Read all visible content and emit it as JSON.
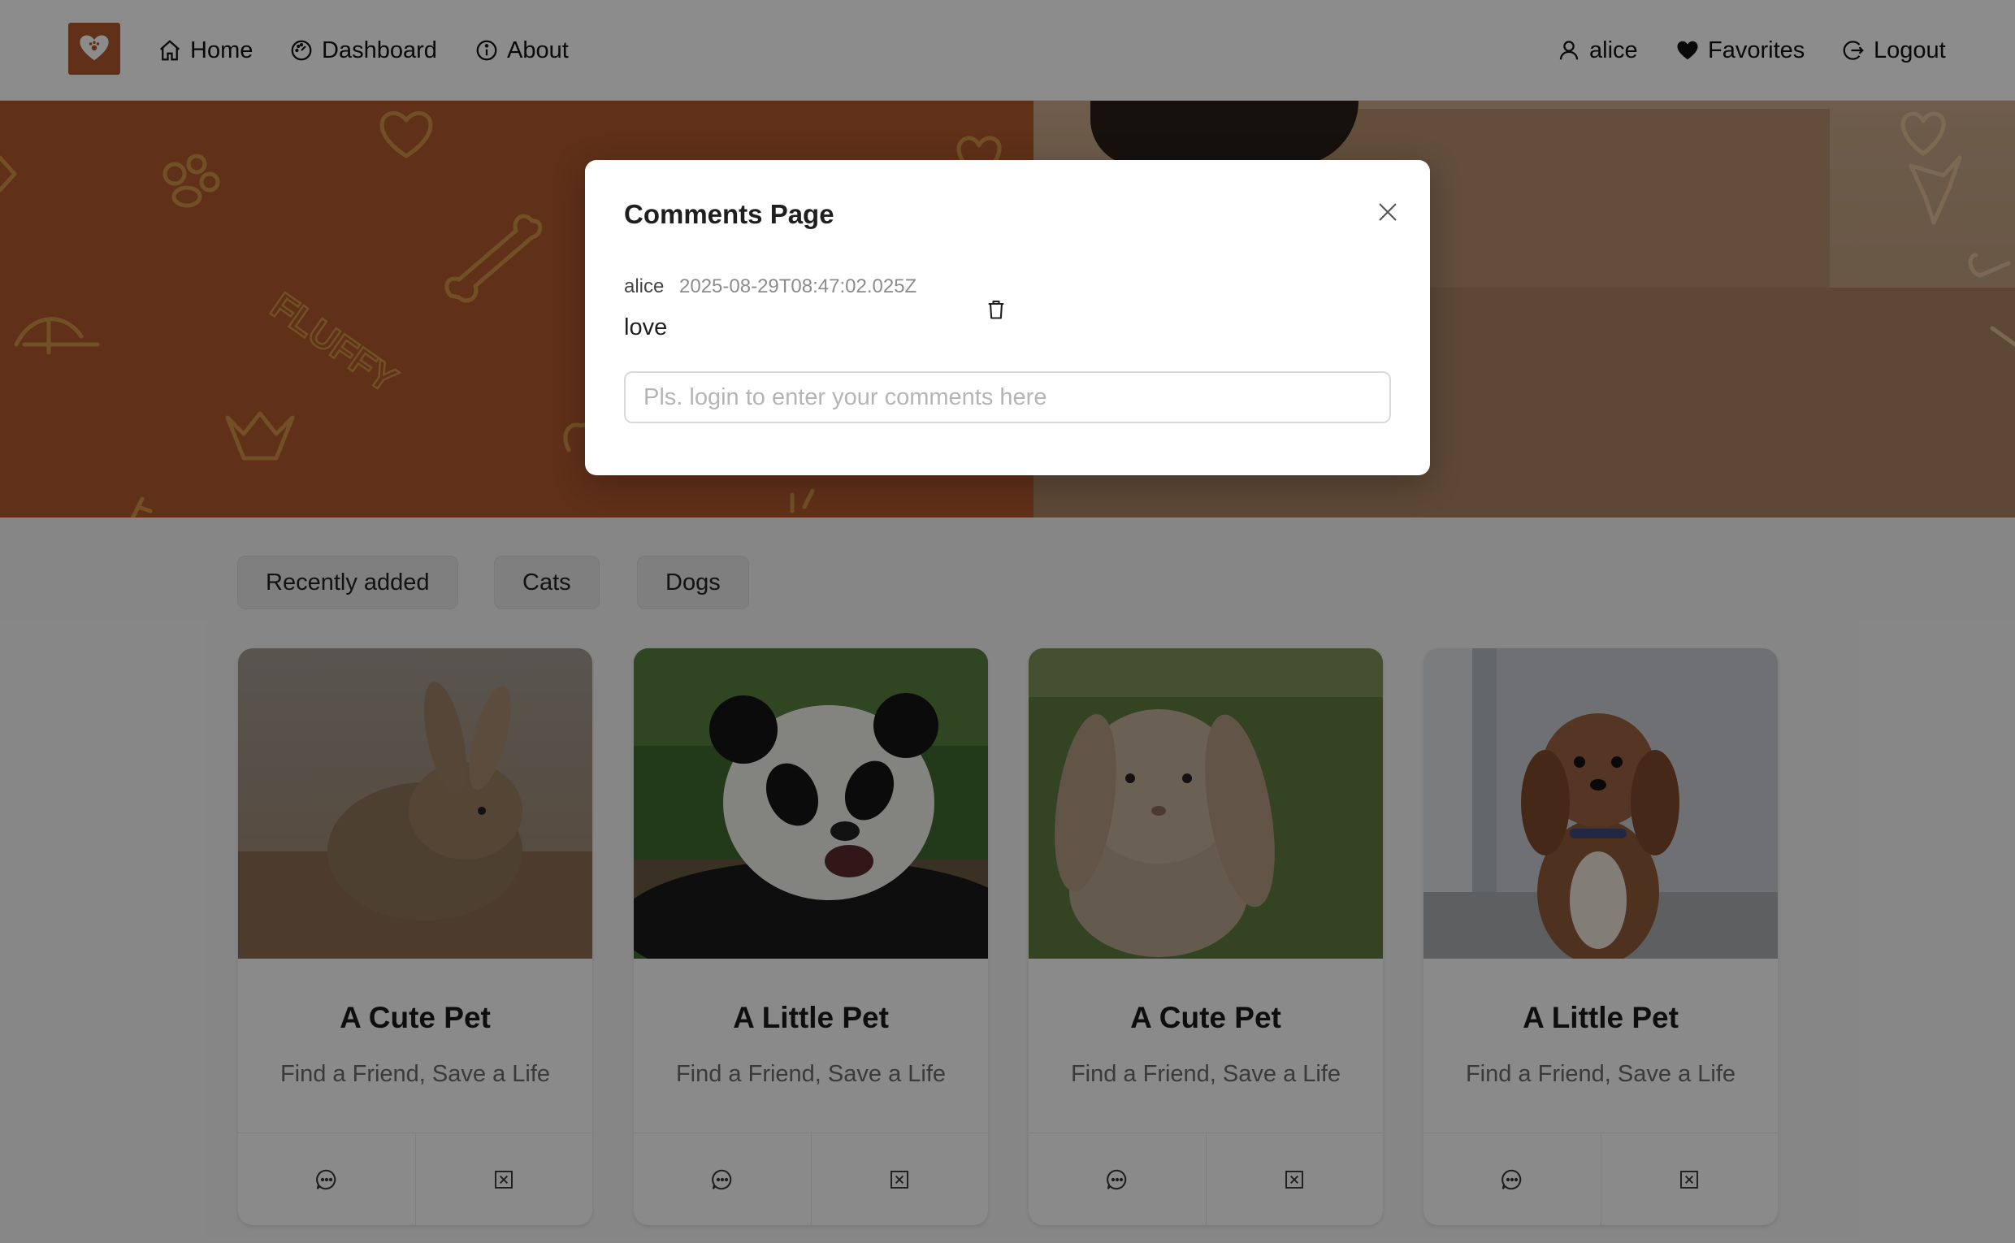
{
  "nav": {
    "home_label": "Home",
    "dashboard_label": "Dashboard",
    "about_label": "About",
    "user_label": "alice",
    "favorites_label": "Favorites",
    "logout_label": "Logout"
  },
  "filters": [
    "Recently added",
    "Cats",
    "Dogs"
  ],
  "cards": [
    {
      "title": "A Cute Pet",
      "subtitle": "Find a Friend, Save a Life"
    },
    {
      "title": "A Little Pet",
      "subtitle": "Find a Friend, Save a Life"
    },
    {
      "title": "A Cute Pet",
      "subtitle": "Find a Friend, Save a Life"
    },
    {
      "title": "A Little Pet",
      "subtitle": "Find a Friend, Save a Life"
    }
  ],
  "modal": {
    "title": "Comments Page",
    "comments": [
      {
        "author": "alice",
        "timestamp": "2025-08-29T08:47:02.025Z",
        "text": "love"
      }
    ],
    "input_placeholder": "Pls. login to enter your comments here"
  },
  "banner": {
    "doodle_text": "FLUFFY"
  },
  "colors": {
    "brand": "#b0582c",
    "overlay": "rgba(0,0,0,0.45)"
  }
}
